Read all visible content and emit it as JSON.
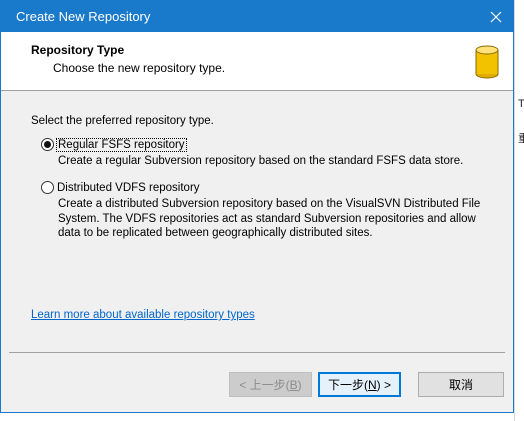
{
  "window": {
    "title": "Create New Repository"
  },
  "header": {
    "title": "Repository Type",
    "subtitle": "Choose the new repository type."
  },
  "content": {
    "prompt": "Select the preferred repository type.",
    "options": [
      {
        "label": "Regular FSFS repository",
        "description": "Create a regular Subversion repository based on the standard FSFS data store.",
        "selected": true
      },
      {
        "label": "Distributed VDFS repository",
        "description": "Create a distributed Subversion repository based on the VisualSVN Distributed File System. The VDFS repositories act as standard Subversion repositories and allow data to be replicated between geographically distributed sites.",
        "selected": false
      }
    ],
    "learn_more": "Learn more about available repository types"
  },
  "buttons": {
    "back": {
      "prefix": "< 上一步(",
      "key": "B",
      "suffix": ")",
      "enabled": false
    },
    "next": {
      "prefix": "下一步(",
      "key": "N",
      "suffix": ") >",
      "enabled": true
    },
    "cancel": {
      "label": "取消"
    }
  },
  "background": {
    "right_chars": [
      "T",
      "重"
    ]
  },
  "colors": {
    "titlebar": "#1979ca",
    "dialog_bg": "#f0f0f0",
    "link": "#0066cc",
    "db_icon": "#f2c200"
  },
  "icons": {
    "close": "close-icon",
    "repository": "database-icon"
  }
}
